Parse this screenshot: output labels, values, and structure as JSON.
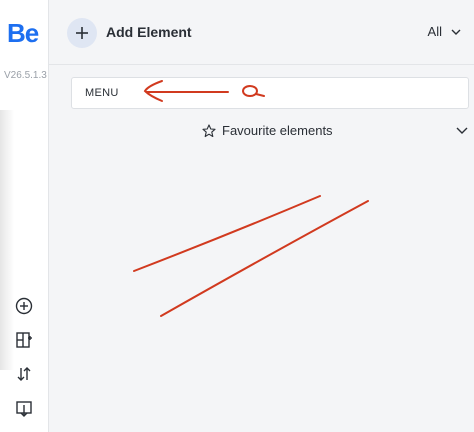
{
  "sidebar": {
    "logo": "Be",
    "version": "V26.5.1.3",
    "icons": [
      "add-circle-icon",
      "layout-add-icon",
      "sort-icon",
      "import-icon"
    ]
  },
  "header": {
    "add_label": "Add Element",
    "filter_value": "All"
  },
  "search": {
    "value": "MENU"
  },
  "favourites": {
    "label": "Favourite elements"
  },
  "colors": {
    "accent": "#1d6ff0",
    "annotation": "#d13a1f"
  }
}
